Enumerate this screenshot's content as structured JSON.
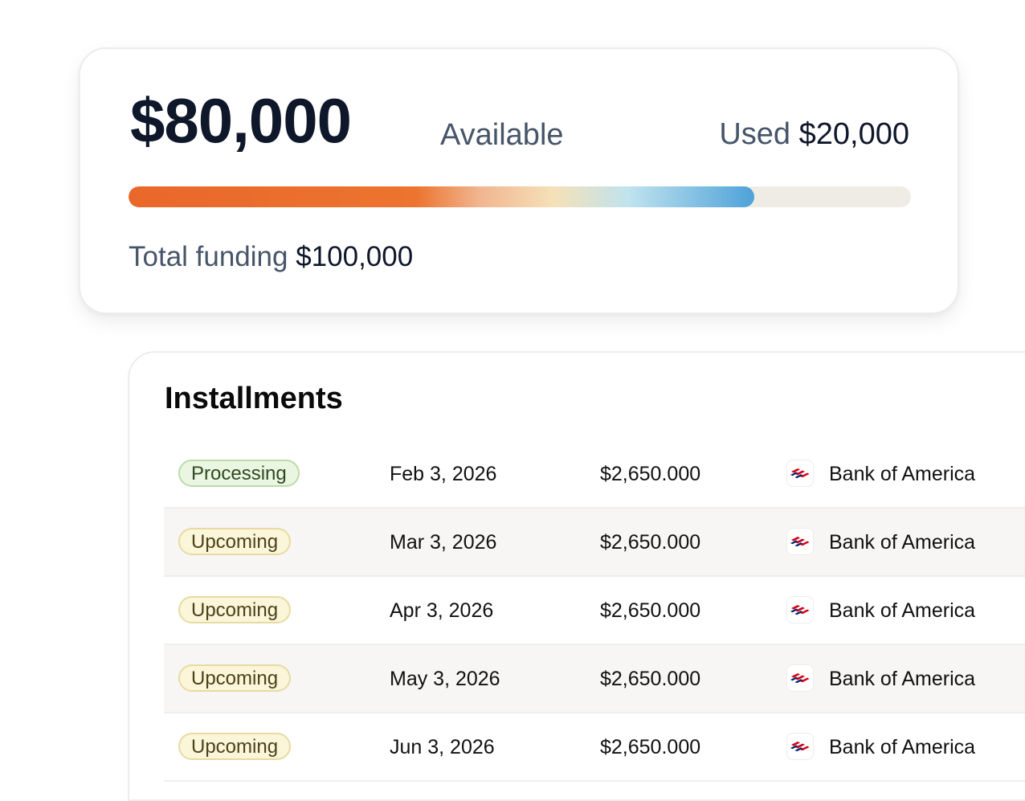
{
  "funding": {
    "available_amount": "$80,000",
    "available_label": "Available",
    "used_label": "Used",
    "used_amount": "$20,000",
    "total_label": "Total funding",
    "total_amount": "$100,000",
    "progress_fraction": 0.8
  },
  "installments": {
    "title": "Installments",
    "rows": [
      {
        "status": "Processing",
        "status_kind": "processing",
        "date": "Feb 3, 2026",
        "amount": "$2,650.000",
        "bank": "Bank of America",
        "bank_icon": "bank-of-america-flag-icon"
      },
      {
        "status": "Upcoming",
        "status_kind": "upcoming",
        "date": "Mar 3, 2026",
        "amount": "$2,650.000",
        "bank": "Bank of America",
        "bank_icon": "bank-of-america-flag-icon"
      },
      {
        "status": "Upcoming",
        "status_kind": "upcoming",
        "date": "Apr 3, 2026",
        "amount": "$2,650.000",
        "bank": "Bank of America",
        "bank_icon": "bank-of-america-flag-icon"
      },
      {
        "status": "Upcoming",
        "status_kind": "upcoming",
        "date": "May 3, 2026",
        "amount": "$2,650.000",
        "bank": "Bank of America",
        "bank_icon": "bank-of-america-flag-icon"
      },
      {
        "status": "Upcoming",
        "status_kind": "upcoming",
        "date": "Jun 3, 2026",
        "amount": "$2,650.000",
        "bank": "Bank of America",
        "bank_icon": "bank-of-america-flag-icon"
      }
    ]
  },
  "colors": {
    "progress_start": "#e9672a",
    "progress_end": "#4ea2d8",
    "track": "#efebe5",
    "processing_bg": "#eaf6e1",
    "upcoming_bg": "#fbf5d9",
    "bank_red": "#d4001a",
    "bank_blue": "#012169"
  }
}
